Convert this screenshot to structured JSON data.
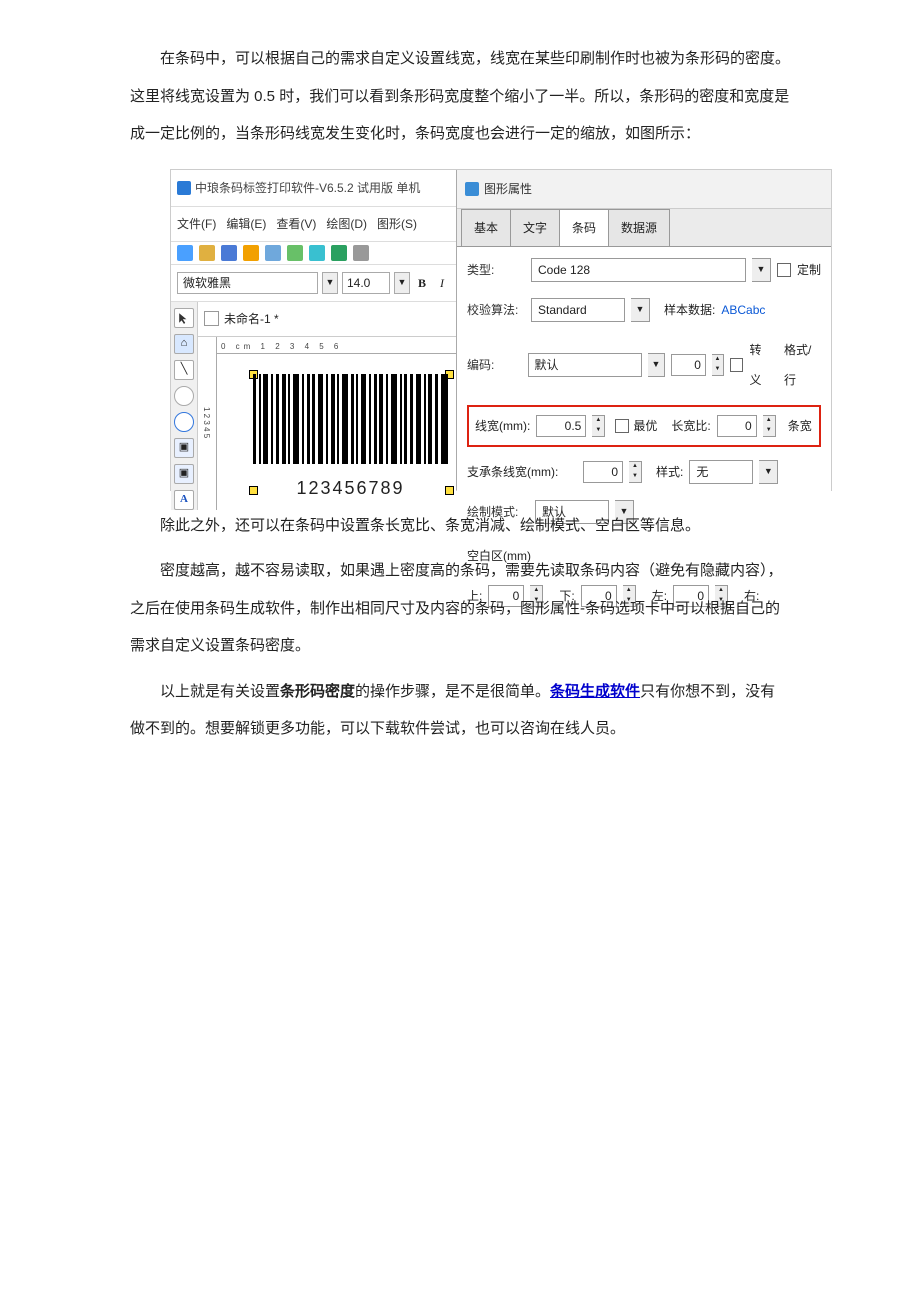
{
  "paragraphs": {
    "p1": "在条码中，可以根据自己的需求自定义设置线宽，线宽在某些印刷制作时也被为条形码的密度。这里将线宽设置为 0.5 时，我们可以看到条形码宽度整个缩小了一半。所以，条形码的密度和宽度是成一定比例的，当条形码线宽发生变化时，条码宽度也会进行一定的缩放，如图所示：",
    "p2": "除此之外，还可以在条码中设置条长宽比、条宽消减、绘制模式、空白区等信息。",
    "p3": "密度越高，越不容易读取，如果遇上密度高的条码，需要先读取条码内容（避免有隐藏内容），之后在使用条码生成软件，制作出相同尺寸及内容的条码，图形属性-条码选项卡中可以根据自己的需求自定义设置条码密度。",
    "p4a": "以上就是有关设置",
    "p4b": "条形码密度",
    "p4c": "的操作步骤，是不是很简单。",
    "p4link": "条码生成软件",
    "p4d": "只有你想不到，没有做不到的。想要解锁更多功能，可以下载软件尝试，也可以咨询在线人员。"
  },
  "app": {
    "title": "中琅条码标签打印软件-V6.5.2 试用版 单机",
    "menus": {
      "file": "文件(F)",
      "edit": "编辑(E)",
      "view": "查看(V)",
      "draw": "绘图(D)",
      "shape": "图形(S)"
    },
    "font_name": "微软雅黑",
    "font_size": "14.0",
    "doc_tab": "未命名-1 *",
    "hruler": "0 cm 1  2  3  4  5  6",
    "barcode_number": "123456789"
  },
  "props": {
    "panel_title": "图形属性",
    "tabs": {
      "basic": "基本",
      "text": "文字",
      "barcode": "条码",
      "datasource": "数据源"
    },
    "labels": {
      "type": "类型:",
      "custom": "定制",
      "checksum": "校验算法:",
      "sample": "样本数据:",
      "encoding": "编码:",
      "escape": "转义",
      "format": "格式/行",
      "linewidth": "线宽(mm):",
      "best": "最优",
      "ratio": "长宽比:",
      "barwidth": "条宽",
      "bearer": "支承条线宽(mm):",
      "style": "样式:",
      "drawmode": "绘制模式:",
      "margins": "空白区(mm)",
      "top": "上:",
      "bottom": "下:",
      "left": "左:",
      "right": "右:"
    },
    "values": {
      "type": "Code 128",
      "checksum": "Standard",
      "sample_data": "ABCabc",
      "encoding": "默认",
      "enc_spin": "0",
      "linewidth": "0.5",
      "ratio": "0",
      "bearer": "0",
      "style": "无",
      "drawmode": "默认",
      "m_top": "0",
      "m_bottom": "0",
      "m_left": "0"
    }
  }
}
